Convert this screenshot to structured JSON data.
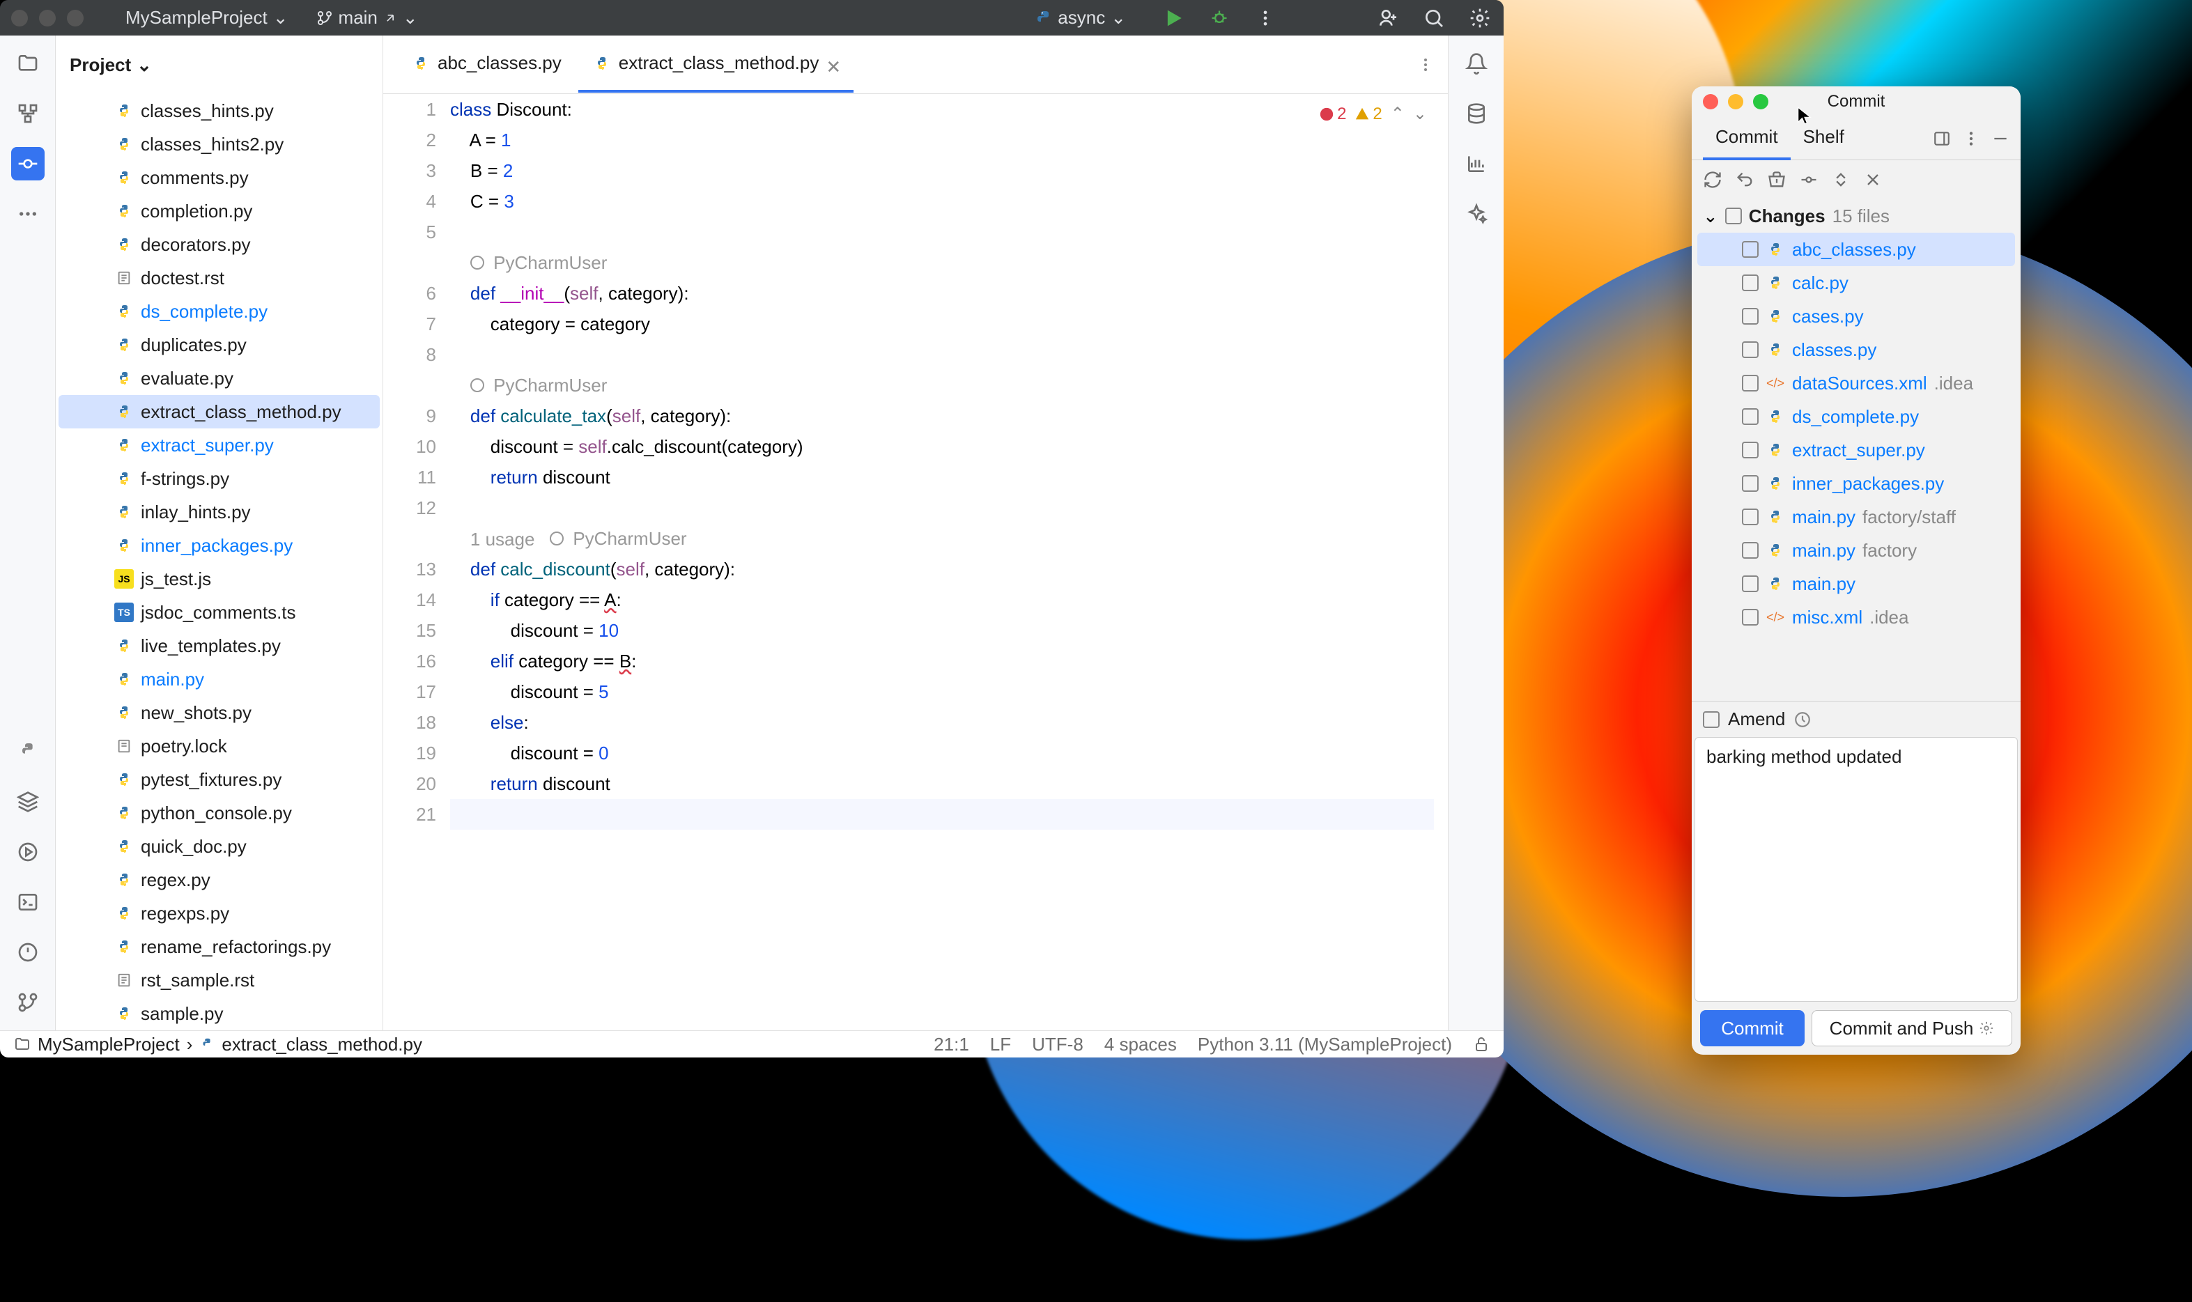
{
  "titlebar": {
    "project_name": "MySampleProject",
    "branch": "main",
    "run_config": "async"
  },
  "project_panel": {
    "header": "Project",
    "files": [
      {
        "name": "classes_hints.py",
        "icon": "py",
        "modified": false
      },
      {
        "name": "classes_hints2.py",
        "icon": "py",
        "modified": false
      },
      {
        "name": "comments.py",
        "icon": "py",
        "modified": false
      },
      {
        "name": "completion.py",
        "icon": "py",
        "modified": false
      },
      {
        "name": "decorators.py",
        "icon": "py",
        "modified": false
      },
      {
        "name": "doctest.rst",
        "icon": "rst",
        "modified": false
      },
      {
        "name": "ds_complete.py",
        "icon": "py",
        "modified": true
      },
      {
        "name": "duplicates.py",
        "icon": "py",
        "modified": false
      },
      {
        "name": "evaluate.py",
        "icon": "py",
        "modified": false
      },
      {
        "name": "extract_class_method.py",
        "icon": "py",
        "modified": false,
        "selected": true
      },
      {
        "name": "extract_super.py",
        "icon": "py",
        "modified": true
      },
      {
        "name": "f-strings.py",
        "icon": "py",
        "modified": false
      },
      {
        "name": "inlay_hints.py",
        "icon": "py",
        "modified": false
      },
      {
        "name": "inner_packages.py",
        "icon": "py",
        "modified": true
      },
      {
        "name": "js_test.js",
        "icon": "js",
        "modified": false
      },
      {
        "name": "jsdoc_comments.ts",
        "icon": "ts",
        "modified": false
      },
      {
        "name": "live_templates.py",
        "icon": "py",
        "modified": false
      },
      {
        "name": "main.py",
        "icon": "py",
        "modified": true
      },
      {
        "name": "new_shots.py",
        "icon": "py",
        "modified": false
      },
      {
        "name": "poetry.lock",
        "icon": "lock",
        "modified": false
      },
      {
        "name": "pytest_fixtures.py",
        "icon": "py",
        "modified": false
      },
      {
        "name": "python_console.py",
        "icon": "py",
        "modified": false
      },
      {
        "name": "quick_doc.py",
        "icon": "py",
        "modified": false
      },
      {
        "name": "regex.py",
        "icon": "py",
        "modified": false
      },
      {
        "name": "regexps.py",
        "icon": "py",
        "modified": false
      },
      {
        "name": "rename_refactorings.py",
        "icon": "py",
        "modified": false
      },
      {
        "name": "rst_sample.rst",
        "icon": "rst",
        "modified": false
      },
      {
        "name": "sample.py",
        "icon": "py",
        "modified": false
      }
    ]
  },
  "tabs": [
    {
      "label": "abc_classes.py",
      "active": false
    },
    {
      "label": "extract_class_method.py",
      "active": true
    }
  ],
  "inspections": {
    "errors": "2",
    "warnings": "2"
  },
  "editor": {
    "author": "PyCharmUser",
    "usage": "1 usage",
    "lines": [
      {
        "n": "1",
        "html": "<span class='kw'>class</span> Discount:"
      },
      {
        "n": "2",
        "html": "    A = <span class='num'>1</span>"
      },
      {
        "n": "3",
        "html": "    B = <span class='num'>2</span>"
      },
      {
        "n": "4",
        "html": "    C = <span class='num'>3</span>"
      },
      {
        "n": "5",
        "html": ""
      },
      {
        "n": "",
        "html": "    <span class='inlay inlay-author'><span class='author-icon'></span> PyCharmUser</span>"
      },
      {
        "n": "6",
        "html": "    <span class='kw'>def</span> <span class='dunder'>__init__</span>(<span class='self'>self</span>, category):"
      },
      {
        "n": "7",
        "html": "        category = category"
      },
      {
        "n": "8",
        "html": ""
      },
      {
        "n": "",
        "html": "    <span class='inlay inlay-author'><span class='author-icon'></span> PyCharmUser</span>"
      },
      {
        "n": "9",
        "html": "    <span class='kw'>def</span> <span class='fn'>calculate_tax</span>(<span class='self'>self</span>, category):"
      },
      {
        "n": "10",
        "html": "        discount = <span class='self'>self</span>.calc_discount(category)"
      },
      {
        "n": "11",
        "html": "        <span class='kw'>return</span> discount"
      },
      {
        "n": "12",
        "html": ""
      },
      {
        "n": "",
        "html": "    <span class='inlay'>1 usage   <span class='inlay-author'><span class='author-icon'></span> PyCharmUser</span></span>"
      },
      {
        "n": "13",
        "html": "    <span class='kw'>def</span> <span class='fn'>calc_discount</span>(<span class='self'>self</span>, category):"
      },
      {
        "n": "14",
        "html": "        <span class='kw'>if</span> category == <span style='text-decoration: underline wavy #db3b4b'>A</span>:"
      },
      {
        "n": "15",
        "html": "            discount = <span class='num'>10</span>"
      },
      {
        "n": "16",
        "html": "        <span class='kw'>elif</span> category == <span style='text-decoration: underline wavy #db3b4b'>B</span>:"
      },
      {
        "n": "17",
        "html": "            discount = <span class='num'>5</span>"
      },
      {
        "n": "18",
        "html": "        <span class='kw'>else</span>:"
      },
      {
        "n": "19",
        "html": "            discount = <span class='num'>0</span>"
      },
      {
        "n": "20",
        "html": "        <span class='kw'>return</span> discount"
      },
      {
        "n": "21",
        "html": "",
        "current": true
      }
    ]
  },
  "status": {
    "breadcrumb_root": "MySampleProject",
    "breadcrumb_file": "extract_class_method.py",
    "position": "21:1",
    "line_ending": "LF",
    "encoding": "UTF-8",
    "indent": "4 spaces",
    "python": "Python 3.11 (MySampleProject)"
  },
  "commit_panel": {
    "title": "Commit",
    "tabs": {
      "commit": "Commit",
      "shelf": "Shelf"
    },
    "changes_label": "Changes",
    "changes_count": "15 files",
    "files": [
      {
        "name": "abc_classes.py",
        "icon": "py",
        "selected": true
      },
      {
        "name": "calc.py",
        "icon": "py"
      },
      {
        "name": "cases.py",
        "icon": "py"
      },
      {
        "name": "classes.py",
        "icon": "py"
      },
      {
        "name": "dataSources.xml",
        "icon": "xml",
        "suffix": ".idea"
      },
      {
        "name": "ds_complete.py",
        "icon": "py"
      },
      {
        "name": "extract_super.py",
        "icon": "py"
      },
      {
        "name": "inner_packages.py",
        "icon": "py"
      },
      {
        "name": "main.py",
        "icon": "py",
        "suffix": "factory/staff"
      },
      {
        "name": "main.py",
        "icon": "py",
        "suffix": "factory"
      },
      {
        "name": "main.py",
        "icon": "py"
      },
      {
        "name": "misc.xml",
        "icon": "xml",
        "suffix": ".idea"
      }
    ],
    "amend_label": "Amend",
    "message": "barking method updated",
    "commit_btn": "Commit",
    "commit_push_btn": "Commit and Push"
  }
}
